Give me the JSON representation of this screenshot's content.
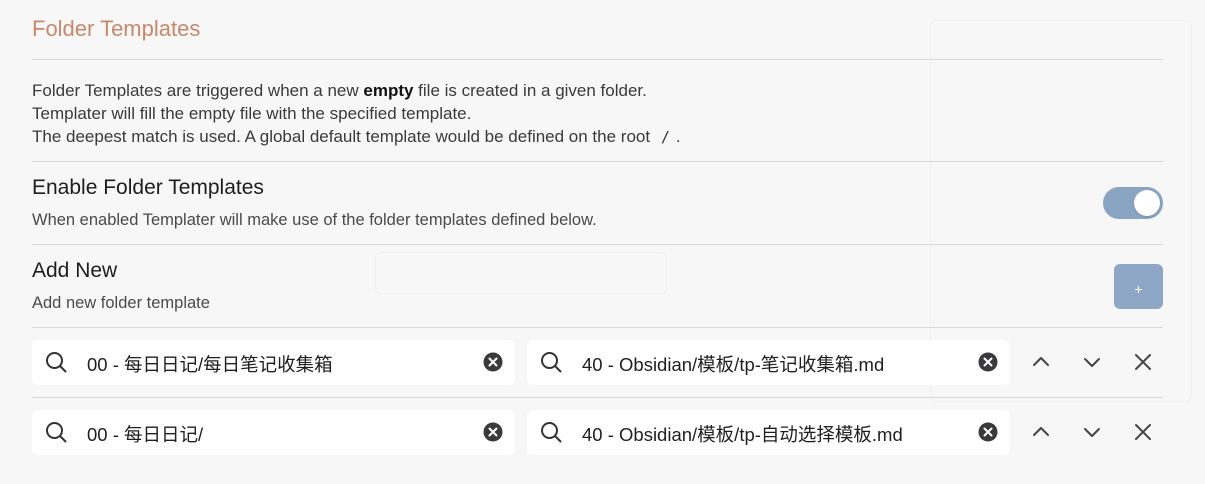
{
  "section": {
    "title": "Folder Templates"
  },
  "description": {
    "line1_pre": "Folder Templates are triggered when a new ",
    "line1_bold": "empty",
    "line1_post": " file is created in a given folder.",
    "line2": "Templater will fill the empty file with the specified template.",
    "line3_pre": "The deepest match is used. A global default template would be defined on the root ",
    "line3_code": "/",
    "line3_post": "."
  },
  "enable_setting": {
    "name": "Enable Folder Templates",
    "description": "When enabled Templater will make use of the folder templates defined below.",
    "enabled": true,
    "accent_color": "#8aa4c4"
  },
  "add_new_setting": {
    "name": "Add New",
    "description": "Add new folder template",
    "button_label": "+",
    "button_color": "#8ea7c6"
  },
  "folder_templates": [
    {
      "folder": "00 - 每日日记/每日笔记收集箱",
      "template": "40 - Obsidian/模板/tp-笔记收集箱.md"
    },
    {
      "folder": "00 - 每日日记/",
      "template": "40 - Obsidian/模板/tp-自动选择模板.md"
    }
  ],
  "colors": {
    "title": "#c9876a",
    "divider": "#d9d9dc",
    "background": "#f7f7f8",
    "input_background": "#ffffff"
  }
}
